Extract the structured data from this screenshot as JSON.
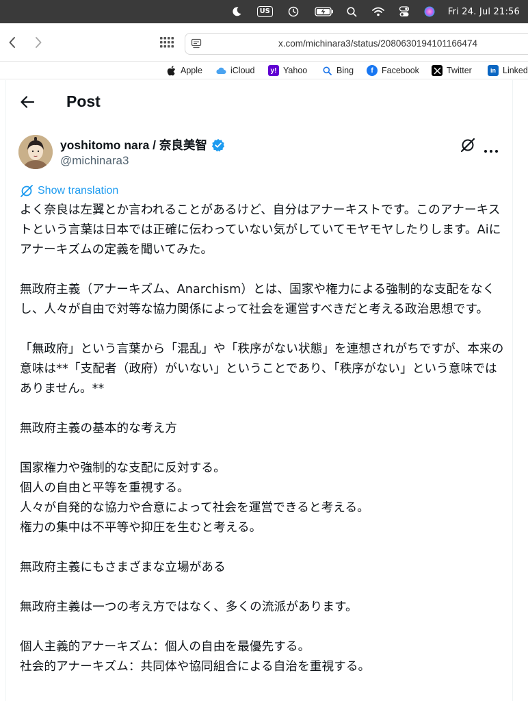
{
  "menubar": {
    "keyboard_layout": "US",
    "datetime": "Fri 24. Jul  21:56",
    "icons": [
      "moon-icon",
      "clock-icon",
      "battery-icon",
      "search-icon",
      "wifi-icon",
      "control-center-icon",
      "siri-icon"
    ]
  },
  "browser": {
    "url": "x.com/michinara3/status/2080630194101166474",
    "bookmarks": [
      {
        "label": "Apple",
        "icon": "apple-icon"
      },
      {
        "label": "iCloud",
        "icon": "icloud-icon"
      },
      {
        "label": "Yahoo",
        "icon": "yahoo-icon"
      },
      {
        "label": "Bing",
        "icon": "bing-icon"
      },
      {
        "label": "Facebook",
        "icon": "facebook-icon"
      },
      {
        "label": "Twitter",
        "icon": "x-icon"
      },
      {
        "label": "Linked",
        "icon": "linkedin-icon"
      }
    ]
  },
  "post": {
    "header_title": "Post",
    "author_name": "yoshitomo nara / 奈良美智",
    "author_handle": "@michinara3",
    "show_translation": "Show translation",
    "body": "よく奈良は左翼とか言われることがあるけど、自分はアナーキストです。このアナーキストという言葉は日本では正確に伝わっていない気がしていてモヤモヤしたりします。Aiにアナーキズムの定義を聞いてみた。\n\n無政府主義（アナーキズム、Anarchism）とは、国家や権力による強制的な支配をなくし、人々が自由で対等な協力関係によって社会を運営すべきだと考える政治思想です。\n\n「無政府」という言葉から「混乱」や「秩序がない状態」を連想されがちですが、本来の意味は**「支配者（政府）がいない」ということであり、「秩序がない」という意味ではありません。**\n\n無政府主義の基本的な考え方\n\n国家権力や強制的な支配に反対する。\n個人の自由と平等を重視する。\n人々が自発的な協力や合意によって社会を運営できると考える。\n権力の集中は不平等や抑圧を生むと考える。\n\n無政府主義にもさまざまな立場がある\n\n無政府主義は一つの考え方ではなく、多くの流派があります。\n\n個人主義的アナーキズム：個人の自由を最優先する。\n社会的アナーキズム：共同体や協同組合による自治を重視する。"
  },
  "colors": {
    "link_blue": "#1d9bf0",
    "handle_gray": "#536471",
    "text": "#0f1419",
    "menubar": "#3a3a3a"
  }
}
